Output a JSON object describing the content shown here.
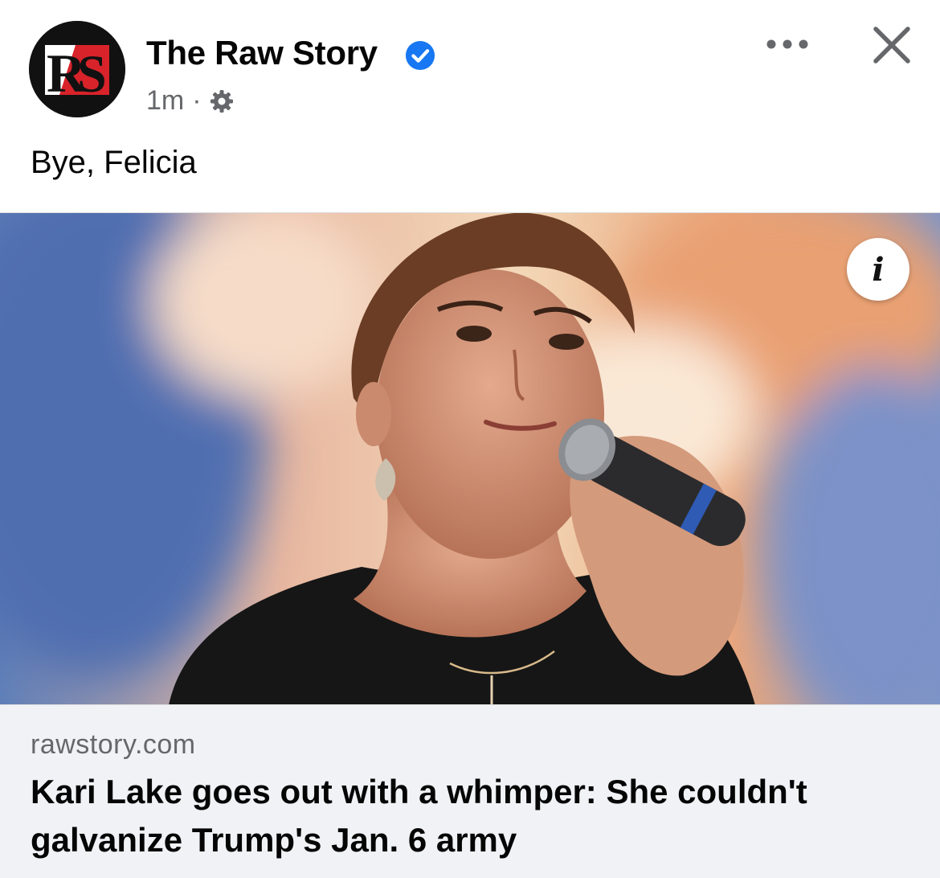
{
  "post": {
    "page_name": "The Raw Story",
    "logo_text": "RS",
    "timestamp": "1m",
    "separator": "·",
    "caption": "Bye, Felicia"
  },
  "link_preview": {
    "domain": "rawstory.com",
    "headline": "Kari Lake goes out with a whimper: She couldn't galvanize Trump's Jan. 6 army",
    "info_icon_label": "i"
  },
  "icons": {
    "verified": "verified-badge-icon",
    "audience": "gear-icon",
    "more": "more-options-icon",
    "close": "close-icon",
    "info": "info-icon"
  },
  "colors": {
    "verified_blue": "#1877f2",
    "logo_red": "#d8232a",
    "secondary_text": "#65676b",
    "card_background": "#f0f2f5"
  }
}
